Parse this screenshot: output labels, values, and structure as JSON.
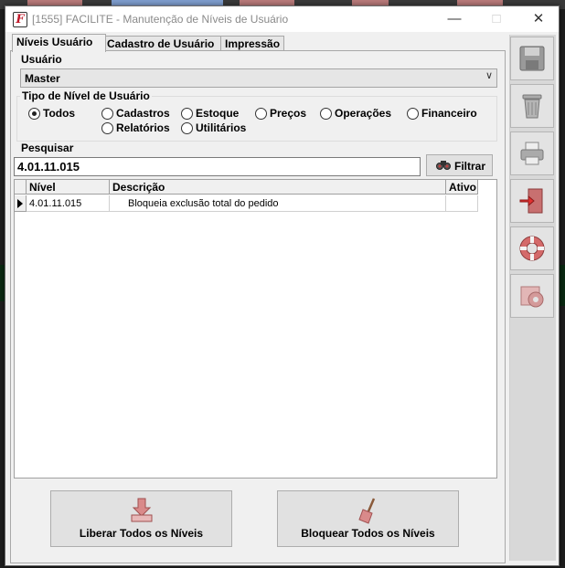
{
  "window": {
    "title": "[1555] FACILITE - Manutenção de Níveis de Usuário",
    "app_icon_letter": "F"
  },
  "tabs": [
    {
      "label": "Níveis Usuário",
      "active": true
    },
    {
      "label": "Cadastro de Usuário",
      "active": false
    },
    {
      "label": "Impressão",
      "active": false
    }
  ],
  "usuario": {
    "label": "Usuário",
    "selected": "Master"
  },
  "tipo_nivel": {
    "title": "Tipo de Nível de Usuário",
    "options": [
      {
        "label": "Todos",
        "checked": true
      },
      {
        "label": "Cadastros",
        "checked": false
      },
      {
        "label": "Estoque",
        "checked": false
      },
      {
        "label": "Preços",
        "checked": false
      },
      {
        "label": "Operações",
        "checked": false
      },
      {
        "label": "Financeiro",
        "checked": false
      },
      {
        "label": "Relatórios",
        "checked": false
      },
      {
        "label": "Utilitários",
        "checked": false
      }
    ]
  },
  "pesquisar": {
    "label": "Pesquisar",
    "value": "4.01.11.015",
    "filter_button": "Filtrar"
  },
  "grid": {
    "columns": [
      "Nível",
      "Descrição",
      "Ativo"
    ],
    "rows": [
      {
        "nivel": "4.01.11.015",
        "descricao": "Bloqueia exclusão total do pedido",
        "ativo": ""
      }
    ]
  },
  "buttons": {
    "liberar": "Liberar Todos os Níveis",
    "bloquear": "Bloquear Todos os Níveis"
  },
  "sidebar_icons": [
    "save-icon",
    "trash-icon",
    "printer-icon",
    "exit-door-icon",
    "lifebuoy-icon",
    "settings-icon"
  ],
  "colors": {
    "accent": "#c0192a",
    "icon_pink": "#d98a8a"
  }
}
